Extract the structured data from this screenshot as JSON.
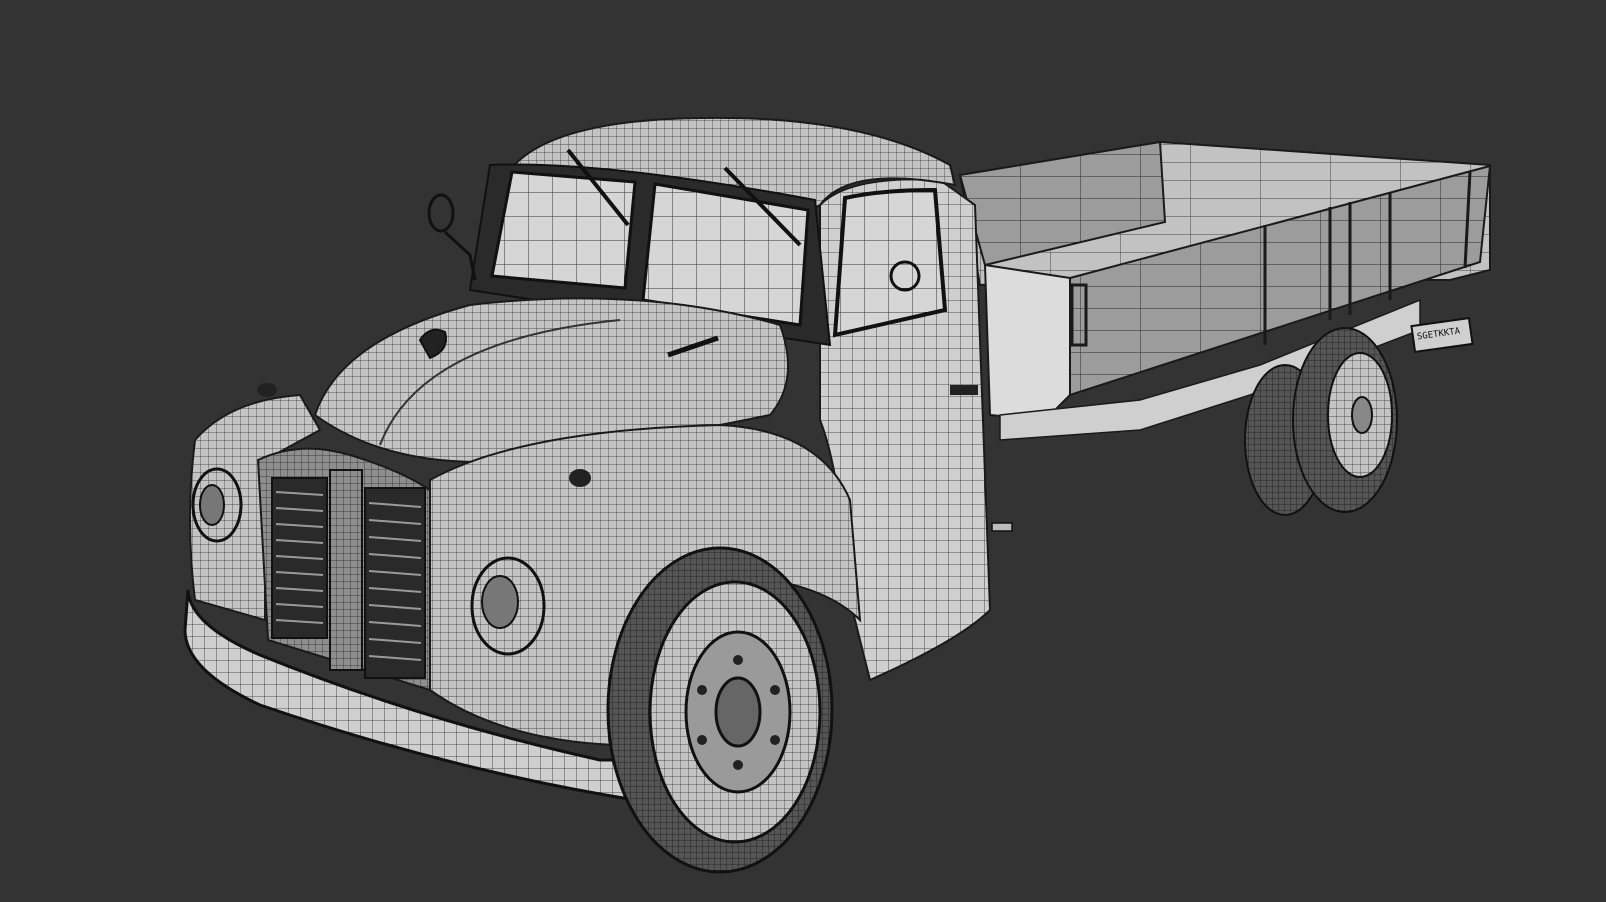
{
  "scene": {
    "subject": "truck-wireframe-model",
    "colors": {
      "background": "#333333",
      "surface": "#c8c8c8",
      "surface_dark": "#8a8a8a",
      "surface_shadow": "#5a5a5a",
      "wire": "#1a1a1a",
      "tire": "#4a4a4a",
      "bed_inner": "#bdbdbd",
      "bed_outer": "#9a9a9a"
    },
    "plate_text": "SGETKKTA"
  }
}
